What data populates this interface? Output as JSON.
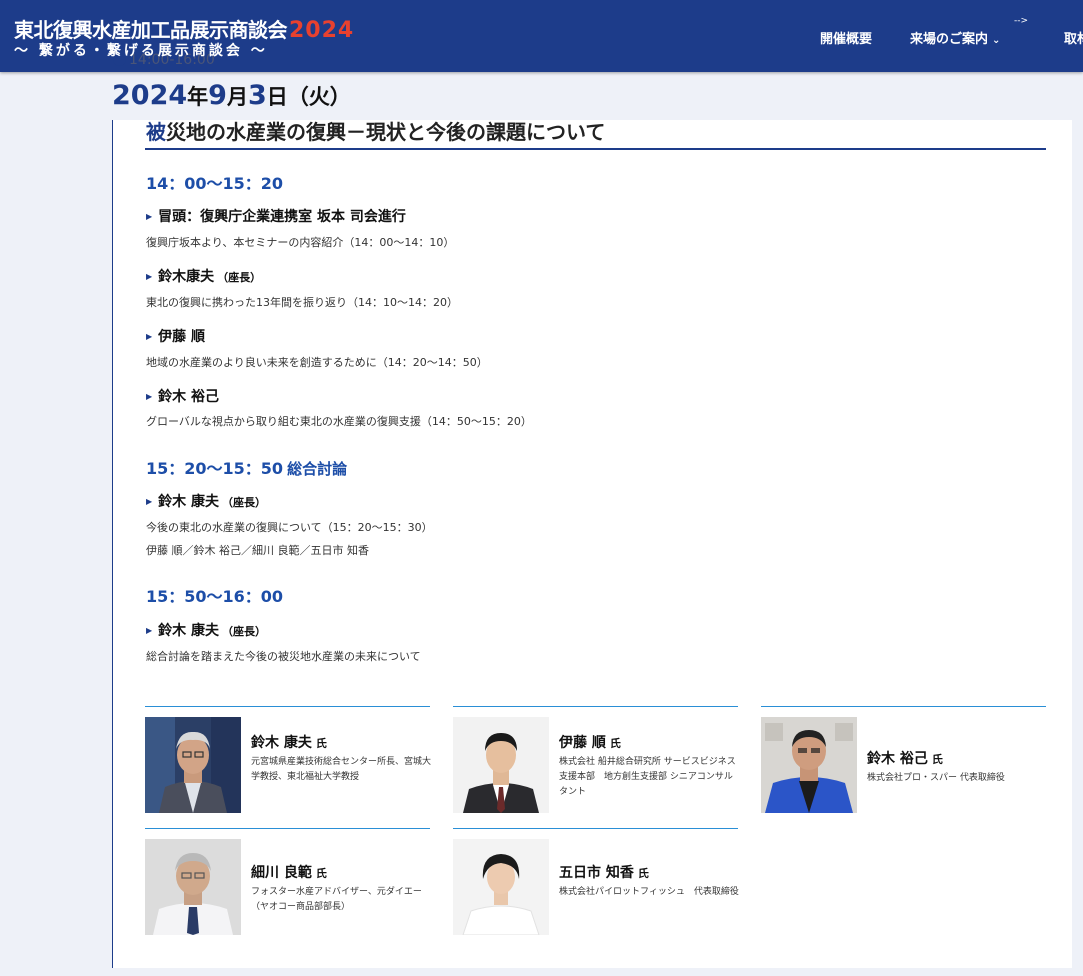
{
  "header": {
    "logo_title": "東北復興水産加工品展示商談会",
    "logo_year": "2024",
    "logo_subtitle": "〜 繋がる・繋げる展示商談会 〜",
    "hidden_time": "14:00-16:00",
    "nav_arrow": "-->",
    "nav": [
      {
        "label": "開催概要"
      },
      {
        "label": "来場のご案内",
        "has_dropdown": true
      },
      {
        "label": "取材"
      }
    ]
  },
  "date": {
    "year": "2024",
    "year_unit": "年",
    "month": "9",
    "month_unit": "月",
    "day": "3",
    "day_unit": "日",
    "weekday": "（火）"
  },
  "session": {
    "title_accent": "被",
    "title_rest": "災地の水産業の復興－現状と今後の課題について",
    "blocks": [
      {
        "time": "14：00〜15：20",
        "tag": ""
      },
      {
        "time": "15：20〜15：50",
        "tag": "総合討論"
      },
      {
        "time": "15：50〜16：00",
        "tag": ""
      }
    ],
    "items": [
      {
        "name": "冒頭：復興庁企業連携室 坂本 司会進行",
        "role": "",
        "desc": "復興庁坂本より、本セミナーの内容紹介（14：00〜14：10）",
        "desc2": ""
      },
      {
        "name": "鈴木康夫",
        "role": "（座長）",
        "desc": "東北の復興に携わった13年間を振り返り（14：10〜14：20）",
        "desc2": ""
      },
      {
        "name": "伊藤 順",
        "role": "",
        "desc": "地域の水産業のより良い未来を創造するために（14：20〜14：50）",
        "desc2": ""
      },
      {
        "name": "鈴木 裕己",
        "role": "",
        "desc": "グローバルな視点から取り組む東北の水産業の復興支援（14：50〜15：20）",
        "desc2": ""
      },
      {
        "name": "鈴木 康夫",
        "role": "（座長）",
        "desc": "今後の東北の水産業の復興について（15：20〜15：30）",
        "desc2": "伊藤 順／鈴木 裕己／細川 良範／五日市 知香"
      },
      {
        "name": "鈴木 康夫",
        "role": "（座長）",
        "desc": "総合討論を踏まえた今後の被災地水産業の未来について",
        "desc2": ""
      }
    ]
  },
  "profiles": [
    {
      "name": "鈴木 康夫",
      "honorific": "氏",
      "affiliation": "元宮城県産業技術総合センター所長、宮城大学教授、東北福祉大学教授"
    },
    {
      "name": "伊藤 順",
      "honorific": "氏",
      "affiliation": "株式会社 船井総合研究所 サービスビジネス支援本部　地方創生支援部 シニアコンサルタント"
    },
    {
      "name": "鈴木 裕己",
      "honorific": "氏",
      "affiliation": "株式会社プロ・スパー 代表取締役"
    },
    {
      "name": "細川 良範",
      "honorific": "氏",
      "affiliation": "フォスター水産アドバイザー、元ダイエー（ヤオコー商品部部長）"
    },
    {
      "name": "五日市 知香",
      "honorific": "氏",
      "affiliation": "株式会社パイロットフィッシュ　代表取締役"
    }
  ],
  "colors": {
    "header_bg": "#1d3c8a",
    "accent_blue": "#1d4ea8",
    "logo_red": "#e8412f",
    "rule_blue": "#2a8fd6"
  },
  "icons": [
    "clock-icon",
    "chevron-down-icon",
    "triangle-bullet-icon"
  ]
}
